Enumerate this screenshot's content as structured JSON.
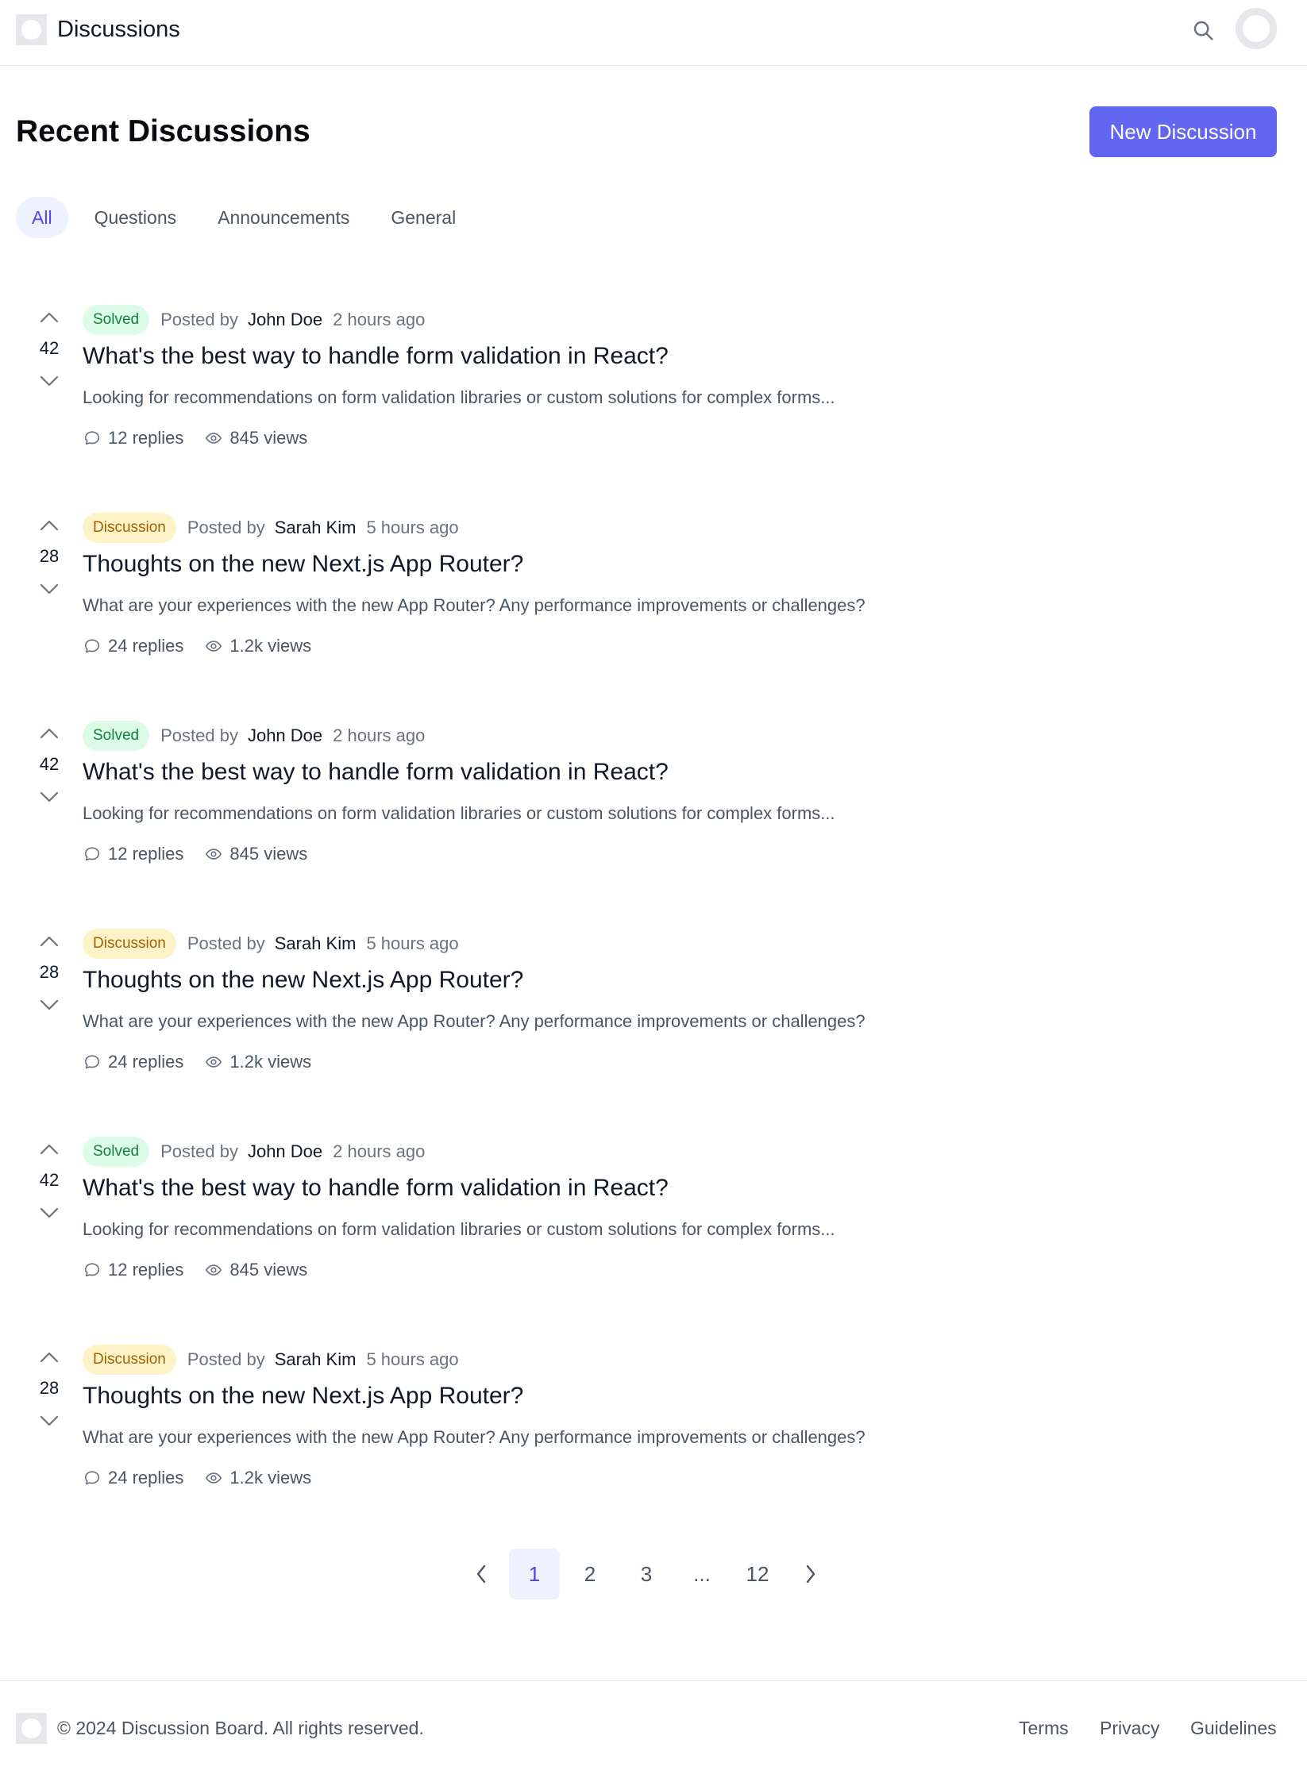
{
  "header": {
    "app_title": "Discussions",
    "logo_icon": "chat-bubble-icon",
    "search_icon": "search-icon",
    "avatar_icon": "user-avatar"
  },
  "page": {
    "title": "Recent Discussions",
    "new_button_label": "New Discussion",
    "accent_color": "#6366f1"
  },
  "tabs": [
    {
      "label": "All",
      "active": true
    },
    {
      "label": "Questions",
      "active": false
    },
    {
      "label": "Announcements",
      "active": false
    },
    {
      "label": "General",
      "active": false
    }
  ],
  "discussions": [
    {
      "votes": "42",
      "badge": "Solved",
      "badge_type": "solved",
      "posted_by_label": "Posted by",
      "author": "John Doe",
      "time": "2 hours ago",
      "title": "What's the best way to handle form validation in React?",
      "excerpt": "Looking for recommendations on form validation libraries or custom solutions for complex forms...",
      "replies": "12 replies",
      "views": "845 views"
    },
    {
      "votes": "28",
      "badge": "Discussion",
      "badge_type": "discussion",
      "posted_by_label": "Posted by",
      "author": "Sarah Kim",
      "time": "5 hours ago",
      "title": "Thoughts on the new Next.js App Router?",
      "excerpt": "What are your experiences with the new App Router? Any performance improvements or challenges?",
      "replies": "24 replies",
      "views": "1.2k views"
    },
    {
      "votes": "42",
      "badge": "Solved",
      "badge_type": "solved",
      "posted_by_label": "Posted by",
      "author": "John Doe",
      "time": "2 hours ago",
      "title": "What's the best way to handle form validation in React?",
      "excerpt": "Looking for recommendations on form validation libraries or custom solutions for complex forms...",
      "replies": "12 replies",
      "views": "845 views"
    },
    {
      "votes": "28",
      "badge": "Discussion",
      "badge_type": "discussion",
      "posted_by_label": "Posted by",
      "author": "Sarah Kim",
      "time": "5 hours ago",
      "title": "Thoughts on the new Next.js App Router?",
      "excerpt": "What are your experiences with the new App Router? Any performance improvements or challenges?",
      "replies": "24 replies",
      "views": "1.2k views"
    },
    {
      "votes": "42",
      "badge": "Solved",
      "badge_type": "solved",
      "posted_by_label": "Posted by",
      "author": "John Doe",
      "time": "2 hours ago",
      "title": "What's the best way to handle form validation in React?",
      "excerpt": "Looking for recommendations on form validation libraries or custom solutions for complex forms...",
      "replies": "12 replies",
      "views": "845 views"
    },
    {
      "votes": "28",
      "badge": "Discussion",
      "badge_type": "discussion",
      "posted_by_label": "Posted by",
      "author": "Sarah Kim",
      "time": "5 hours ago",
      "title": "Thoughts on the new Next.js App Router?",
      "excerpt": "What are your experiences with the new App Router? Any performance improvements or challenges?",
      "replies": "24 replies",
      "views": "1.2k views"
    }
  ],
  "pagination": {
    "pages": [
      "1",
      "2",
      "3",
      "...",
      "12"
    ],
    "current": "1"
  },
  "footer": {
    "copyright": "© 2024 Discussion Board. All rights reserved.",
    "links": [
      "Terms",
      "Privacy",
      "Guidelines"
    ]
  }
}
